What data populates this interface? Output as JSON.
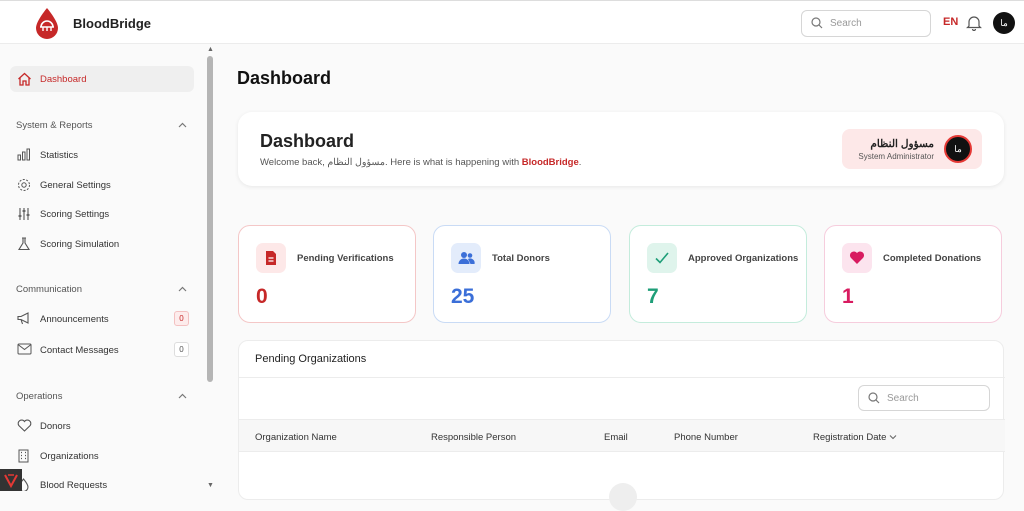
{
  "header": {
    "brand": "BloodBridge",
    "search_placeholder": "Search",
    "language": "EN",
    "avatar_initials": "ما"
  },
  "sidebar": {
    "dashboard": "Dashboard",
    "sections": [
      {
        "title": "System & Reports",
        "items": [
          "Statistics",
          "General Settings",
          "Scoring Settings",
          "Scoring Simulation"
        ]
      },
      {
        "title": "Communication",
        "items": [
          "Announcements",
          "Contact Messages"
        ]
      },
      {
        "title": "Operations",
        "items": [
          "Donors",
          "Organizations",
          "Blood Requests"
        ]
      }
    ],
    "badges": {
      "announcements": "0",
      "contact_messages": "0"
    }
  },
  "main": {
    "page_title": "Dashboard",
    "welcome": {
      "title": "Dashboard",
      "prefix": "Welcome back, ",
      "user_name": "مسؤول النظام",
      "middle": ". Here is what is happening with ",
      "brand": "BloodBridge",
      "suffix": "."
    },
    "user_chip": {
      "name": "مسؤول النظام",
      "role": "System Administrator",
      "initials": "ما"
    },
    "stats": [
      {
        "label": "Pending Verifications",
        "value": "0",
        "icon": "document-icon",
        "color": "#c62828",
        "bg": "#fde8e8",
        "border": "#f4c7c7"
      },
      {
        "label": "Total Donors",
        "value": "25",
        "icon": "users-icon",
        "color": "#3b6fd8",
        "bg": "#e3ecfb",
        "border": "#c9dbf5"
      },
      {
        "label": "Approved Organizations",
        "value": "7",
        "icon": "check-icon",
        "color": "#1e9e78",
        "bg": "#dff4ec",
        "border": "#c4ecdc"
      },
      {
        "label": "Completed Donations",
        "value": "1",
        "icon": "heart-icon",
        "color": "#d81b60",
        "bg": "#fce4ee",
        "border": "#f6cddd"
      }
    ],
    "pending_orgs": {
      "title": "Pending Organizations",
      "search_placeholder": "Search",
      "columns": [
        "Organization Name",
        "Responsible Person",
        "Email",
        "Phone Number",
        "Registration Date"
      ]
    }
  }
}
